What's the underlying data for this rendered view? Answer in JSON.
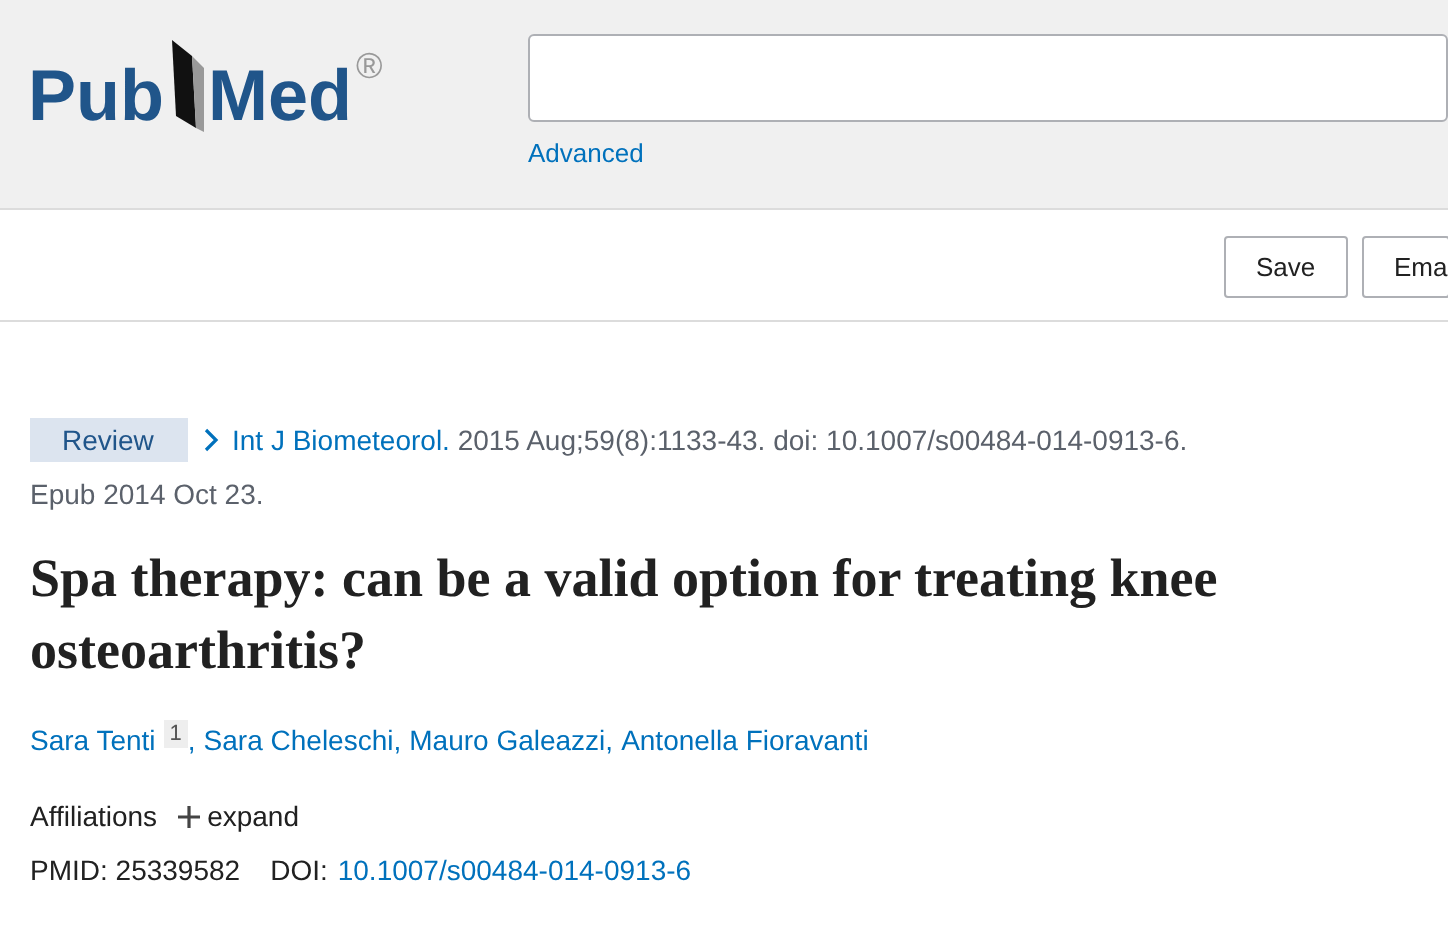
{
  "logo": {
    "left": "Pub",
    "right": "Med",
    "mark": "®"
  },
  "advanced_link": "Advanced",
  "toolbar": [
    "Save",
    "Ema"
  ],
  "publication_type": "Review",
  "citation": {
    "journal": "Int J Biometeorol.",
    "details": "2015 Aug;59(8):1133-43. doi: 10.1007/s00484-014-0913-6.",
    "epub": "Epub 2014 Oct 23."
  },
  "title": "Spa therapy: can be a valid option for treating knee osteoarthritis?",
  "authors": [
    {
      "name": "Sara Tenti",
      "affiliation": "1",
      "sep": ","
    },
    {
      "name": "Sara Cheleschi",
      "sep": ","
    },
    {
      "name": "Mauro Galeazzi",
      "sep": ","
    },
    {
      "name": "Antonella Fioravanti"
    }
  ],
  "affiliations": {
    "label": "Affiliations",
    "toggle": "expand",
    "expanded": false
  },
  "identifiers": {
    "pmid_label": "PMID:",
    "pmid": "25339582",
    "doi_label": "DOI:",
    "doi": "10.1007/s00484-014-0913-6"
  }
}
